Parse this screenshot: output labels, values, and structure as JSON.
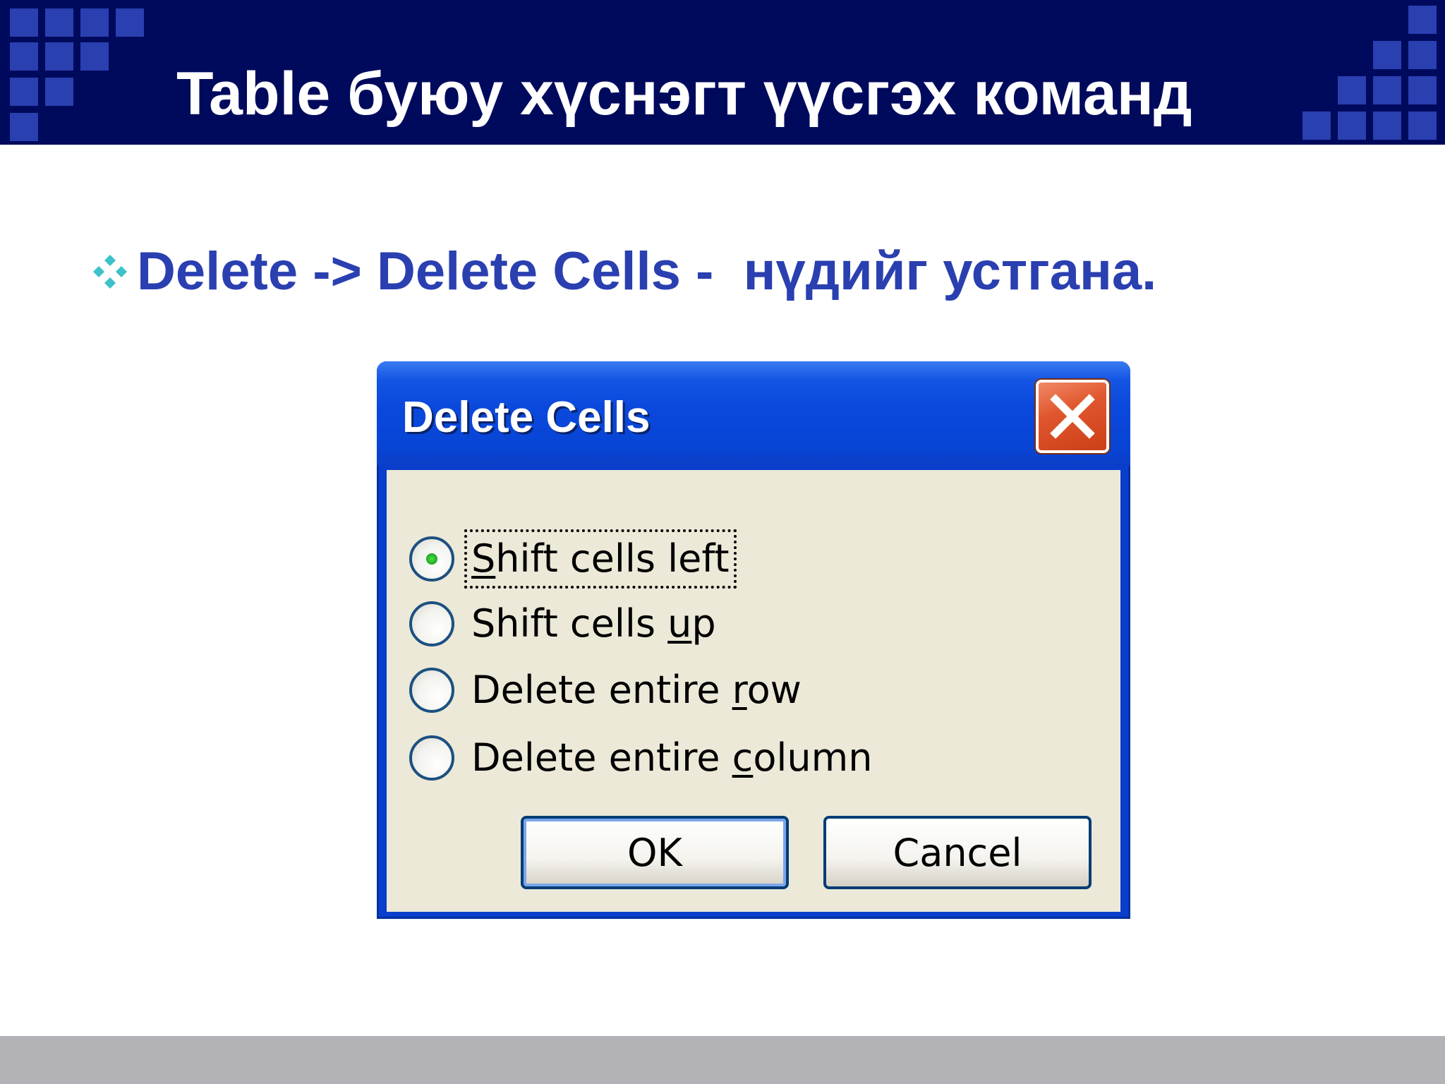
{
  "slide": {
    "title": "Table буюу хүснэгт үүсгэх команд",
    "bullet_text": "Delete -> Delete Cells -  нүдийг устгана."
  },
  "dialog": {
    "title": "Delete Cells",
    "close_icon": "close-x-icon",
    "options": [
      {
        "label_pre": "",
        "label_acc": "S",
        "label_post": "hift cells left",
        "selected": true
      },
      {
        "label_pre": "Shift cells ",
        "label_acc": "u",
        "label_post": "p",
        "selected": false
      },
      {
        "label_pre": "Delete entire ",
        "label_acc": "r",
        "label_post": "ow",
        "selected": false
      },
      {
        "label_pre": "Delete entire ",
        "label_acc": "c",
        "label_post": "olumn",
        "selected": false
      }
    ],
    "ok_label": "OK",
    "cancel_label": "Cancel"
  },
  "colors": {
    "header_bg": "#000a5c",
    "accent_blue": "#2a3fb0",
    "bullet_teal": "#3cc2c8",
    "dialog_face": "#ece9d8",
    "close_red": "#e0562e"
  }
}
